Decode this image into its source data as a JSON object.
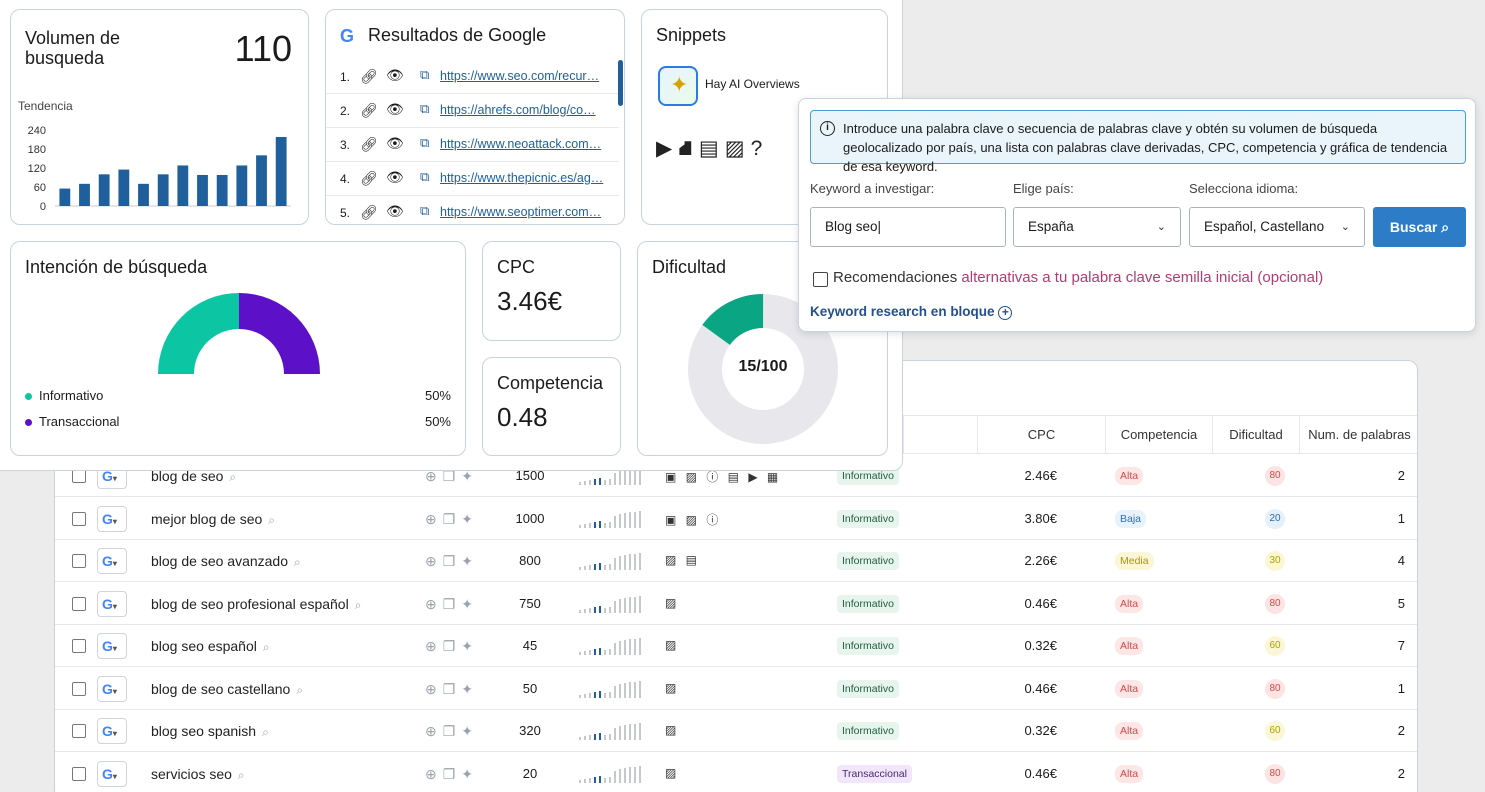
{
  "volumen": {
    "title": "Volumen de busqueda",
    "value": "110",
    "trend_label": "Tendencia",
    "y_ticks": [
      "240",
      "180",
      "120",
      "60",
      "0"
    ],
    "bars": [
      55,
      70,
      100,
      115,
      70,
      100,
      128,
      98,
      98,
      128,
      160,
      218
    ],
    "bar_color": "#1f5f9c",
    "y_max": 240
  },
  "google": {
    "title": "Resultados de Google",
    "results": [
      {
        "n": "1.",
        "url": "https://www.seo.com/recur…"
      },
      {
        "n": "2.",
        "url": "https://ahrefs.com/blog/co…"
      },
      {
        "n": "3.",
        "url": "https://www.neoattack.com…"
      },
      {
        "n": "4.",
        "url": "https://www.thepicnic.es/ag…"
      },
      {
        "n": "5.",
        "url": "https://www.seoptimer.com…"
      }
    ]
  },
  "snippets": {
    "title": "Snippets",
    "ai": "Hay AI Overviews",
    "icons": [
      "video-icon",
      "map-icon",
      "news-icon",
      "image-icon",
      "question-icon"
    ]
  },
  "intencion": {
    "title": "Intención de búsqueda",
    "items": [
      {
        "label": "Informativo",
        "pct": "50%",
        "color": "#0cc6a3"
      },
      {
        "label": "Transaccional",
        "pct": "50%",
        "color": "#5c10c8"
      }
    ]
  },
  "cpc": {
    "title": "CPC",
    "value": "3.46€"
  },
  "competencia": {
    "title": "Competencia",
    "value": "0.48"
  },
  "dificultad": {
    "title": "Dificultad",
    "value": "15/100",
    "fraction": 0.15,
    "color": "#0aa683"
  },
  "popup": {
    "info": "Introduce una palabra clave o secuencia de palabras clave y obtén su volumen de búsqueda geolocalizado por país, una lista con palabras clave derivadas, CPC, competencia y gráfica de tendencia de esa keyword.",
    "kw_label": "Keyword a investigar:",
    "kw_value": "Blog seo|",
    "pais_label": "Elige país:",
    "pais_value": "España",
    "idioma_label": "Selecciona idioma:",
    "idioma_value": "Español, Castellano",
    "buscar": "Buscar",
    "recom_a": "Recomendaciones ",
    "recom_b": "alternativas a tu palabra clave semilla inicial (opcional)",
    "bloque": "Keyword research en bloque"
  },
  "table": {
    "headers": {
      "cpc": "CPC",
      "comp": "Competencia",
      "dif": "Dificultad",
      "num": "Num. de palabras"
    },
    "rows": [
      {
        "kw": "blog de seo",
        "vol": "1500",
        "serp": "▣ ▨ ⓘ ▤ ▶ ▦",
        "intent": "Informativo",
        "cpc": "2.46€",
        "comp": "Alta",
        "dif": "80",
        "num": "2"
      },
      {
        "kw": "mejor blog de seo",
        "vol": "1000",
        "serp": "▣ ▨ ⓘ",
        "intent": "Informativo",
        "cpc": "3.80€",
        "comp": "Baja",
        "dif": "20",
        "num": "1"
      },
      {
        "kw": "blog de seo avanzado",
        "vol": "800",
        "serp": "▨ ▤",
        "intent": "Informativo",
        "cpc": "2.26€",
        "comp": "Media",
        "dif": "30",
        "num": "4"
      },
      {
        "kw": "blog de seo profesional español",
        "vol": "750",
        "serp": "▨",
        "intent": "Informativo",
        "cpc": "0.46€",
        "comp": "Alta",
        "dif": "80",
        "num": "5"
      },
      {
        "kw": "blog seo español",
        "vol": "45",
        "serp": "▨",
        "intent": "Informativo",
        "cpc": "0.32€",
        "comp": "Alta",
        "dif": "60",
        "num": "7"
      },
      {
        "kw": "blog de seo castellano",
        "vol": "50",
        "serp": "▨",
        "intent": "Informativo",
        "cpc": "0.46€",
        "comp": "Alta",
        "dif": "80",
        "num": "1"
      },
      {
        "kw": "blog seo spanish",
        "vol": "320",
        "serp": "▨",
        "intent": "Informativo",
        "cpc": "0.32€",
        "comp": "Alta",
        "dif": "60",
        "num": "2"
      },
      {
        "kw": "servicios seo",
        "vol": "20",
        "serp": "▨",
        "intent": "Transaccional",
        "cpc": "0.46€",
        "comp": "Alta",
        "dif": "80",
        "num": "2"
      }
    ]
  }
}
